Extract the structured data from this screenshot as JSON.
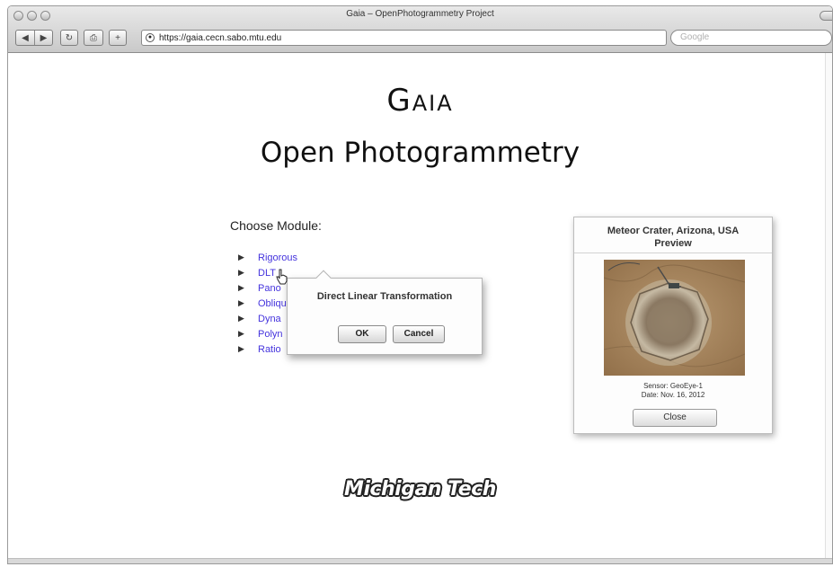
{
  "window": {
    "title": "Gaia – OpenPhotogrammetry Project"
  },
  "toolbar": {
    "back_icon": "back-arrow-icon",
    "forward_icon": "forward-arrow-icon",
    "url": "https://gaia.cecn.sabo.mtu.edu",
    "search_placeholder": "Google"
  },
  "page": {
    "title": "Gaia",
    "subtitle": "Open Photogrammetry",
    "choose_label": "Choose Module:",
    "modules": [
      {
        "label": "Rigorous"
      },
      {
        "label": "DLT"
      },
      {
        "label": "Pano"
      },
      {
        "label": "Obliqu"
      },
      {
        "label": "Dyna"
      },
      {
        "label": "Polyn"
      },
      {
        "label": "Ratio"
      }
    ],
    "logo_text": "Michigan Tech"
  },
  "dialog": {
    "title": "Direct Linear Transformation",
    "ok_label": "OK",
    "cancel_label": "Cancel"
  },
  "preview": {
    "title_line1": "Meteor Crater, Arizona, USA",
    "title_line2": "Preview",
    "sensor": "Sensor: GeoEye-1",
    "date": "Date: Nov. 16, 2012",
    "close_label": "Close"
  },
  "colors": {
    "link": "#4433dd",
    "crater_rim": "#8a7a66",
    "terrain": "#a88a62"
  }
}
